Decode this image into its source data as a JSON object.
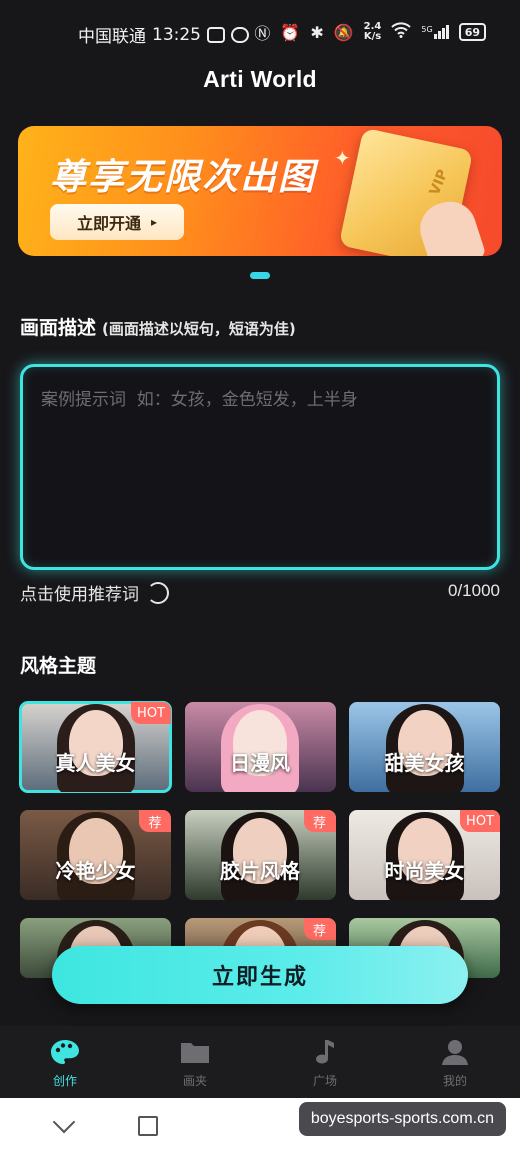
{
  "status_bar": {
    "carrier": "中国联通",
    "time": "13:25",
    "net_speed_value": "2.4",
    "net_speed_unit": "K/s",
    "signal_label": "5G",
    "battery": "69"
  },
  "header": {
    "title": "Arti World"
  },
  "banner": {
    "headline": "尊享无限次出图",
    "button_label": "立即开通",
    "button_arrow": "▸",
    "card_label": "VIP"
  },
  "description": {
    "title": "画面描述",
    "hint": "(画面描述以短句，短语为佳)",
    "placeholder": "案例提示词  如：女孩，金色短发，上半身",
    "value": "",
    "suggest_label": "点击使用推荐词",
    "counter": "0/1000"
  },
  "styles": {
    "title": "风格主题",
    "items": [
      {
        "label": "真人美女",
        "badge": "HOT",
        "selected": true,
        "bg": "#5b6b7a",
        "bg2": "#d8d4cf",
        "hair": "#2a1d1a",
        "skin": "#f3d6c8"
      },
      {
        "label": "日漫风",
        "badge": "",
        "selected": false,
        "bg": "#4a3450",
        "bg2": "#c98aa6",
        "hair": "#f2a9c1",
        "skin": "#f7e3dc"
      },
      {
        "label": "甜美女孩",
        "badge": "",
        "selected": false,
        "bg": "#3f6fa0",
        "bg2": "#9cc6e8",
        "hair": "#1e1614",
        "skin": "#f2d3c3"
      },
      {
        "label": "冷艳少女",
        "badge": "荐",
        "selected": false,
        "bg": "#3a2c25",
        "bg2": "#7a5a46",
        "hair": "#2b1c14",
        "skin": "#e9c7b2"
      },
      {
        "label": "胶片风格",
        "badge": "荐",
        "selected": false,
        "bg": "#2e3a2c",
        "bg2": "#c7cfc0",
        "hair": "#1b1311",
        "skin": "#efd0c0"
      },
      {
        "label": "时尚美女",
        "badge": "HOT",
        "selected": false,
        "bg": "#c9c2bc",
        "bg2": "#efe9e4",
        "hair": "#1c1412",
        "skin": "#f1d2c2"
      },
      {
        "label": "",
        "badge": "",
        "selected": false,
        "bg": "#3d4a3a",
        "bg2": "#8aa07e",
        "hair": "#2a1e18",
        "skin": "#e8c8b6"
      },
      {
        "label": "",
        "badge": "荐",
        "selected": false,
        "bg": "#5a4a3a",
        "bg2": "#b89a78",
        "hair": "#6a3a22",
        "skin": "#efcdb8"
      },
      {
        "label": "",
        "badge": "",
        "selected": false,
        "bg": "#3f6a4a",
        "bg2": "#a8c8a0",
        "hair": "#2a1c16",
        "skin": "#edcdbb"
      }
    ]
  },
  "generate_button": {
    "label": "立即生成"
  },
  "tab_bar": {
    "tabs": [
      {
        "label": "创作",
        "icon": "palette-icon",
        "active": true
      },
      {
        "label": "画夹",
        "icon": "folder-icon",
        "active": false
      },
      {
        "label": "广场",
        "icon": "music-note-icon",
        "active": false
      },
      {
        "label": "我的",
        "icon": "user-icon",
        "active": false
      }
    ]
  },
  "watermark": "boyesports-sports.com.cn",
  "colors": {
    "accent": "#3fe3e0",
    "background": "#17171a",
    "badge": "#ff6b63"
  }
}
